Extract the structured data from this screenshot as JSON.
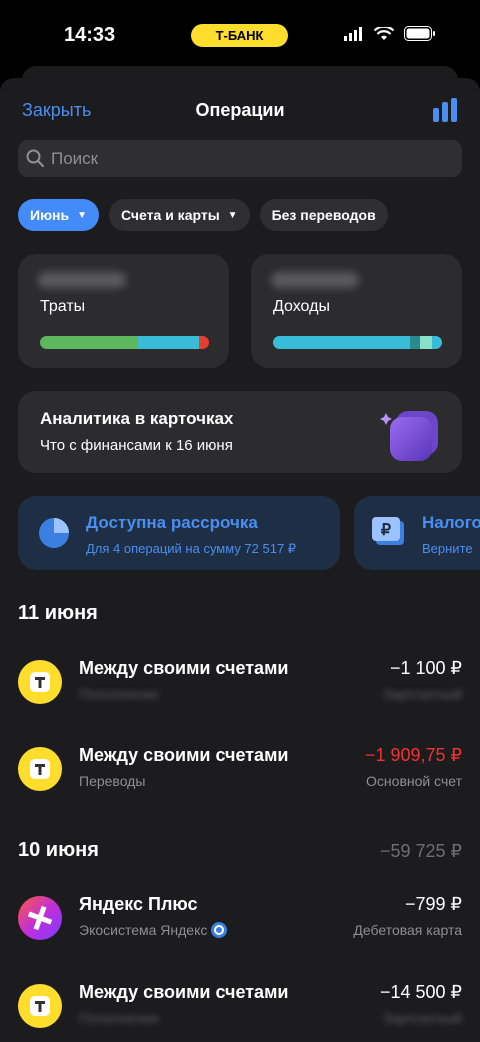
{
  "status_bar": {
    "time": "14:33",
    "bank_badge": "Т-БАНК"
  },
  "header": {
    "close": "Закрыть",
    "title": "Операции"
  },
  "search": {
    "placeholder": "Поиск"
  },
  "filters": [
    {
      "label": "Июнь",
      "active": true,
      "dropdown": true
    },
    {
      "label": "Счета и карты",
      "active": false,
      "dropdown": true
    },
    {
      "label": "Без переводов",
      "active": false,
      "dropdown": false
    }
  ],
  "stats": {
    "spending": {
      "label": "Траты",
      "segments": [
        {
          "color": "#5cb75f",
          "share": 0.58
        },
        {
          "color": "#38bcd8",
          "share": 0.36
        },
        {
          "color": "#e83d2e",
          "share": 0.06
        }
      ]
    },
    "income": {
      "label": "Доходы",
      "segments": [
        {
          "color": "#38bcd8",
          "share": 0.81
        },
        {
          "color": "#2a8a92",
          "share": 0.06
        },
        {
          "color": "#88e0c8",
          "share": 0.07
        },
        {
          "color": "#38bcd8",
          "share": 0.06
        }
      ]
    }
  },
  "analytics_card": {
    "title": "Аналитика в карточках",
    "subtitle": "Что с финансами к 16 июня"
  },
  "promos": [
    {
      "title": "Доступна рассрочка",
      "subtitle": "Для 4 операций на сумму 72 517 ₽",
      "icon": "pie-chart-icon"
    },
    {
      "title": "Налоговый вычет",
      "subtitle": "Верните",
      "icon": "ruble-document-icon"
    }
  ],
  "days": [
    {
      "date": "11 июня",
      "total": "",
      "operations": [
        {
          "name": "Между своими счетами",
          "category": "Пополнение",
          "amount": "−1 100 ₽",
          "account": "Зарплатный",
          "amount_color": "#ffffff",
          "blur_details": true,
          "logo": "tbank-logo"
        },
        {
          "name": "Между своими счетами",
          "category": "Переводы",
          "amount": "−1 909,75 ₽",
          "account": "Основной счет",
          "amount_color": "#f0332e",
          "blur_details": false,
          "logo": "tbank-logo"
        }
      ]
    },
    {
      "date": "10 июня",
      "total": "−59 725 ₽",
      "operations": [
        {
          "name": "Яндекс Плюс",
          "category": "Экосистема Яндекс",
          "amount": "−799 ₽",
          "account": "Дебетовая карта",
          "amount_color": "#ffffff",
          "blur_details": false,
          "logo": "yandex-plus-logo"
        },
        {
          "name": "Между своими счетами",
          "category": "Пополнение",
          "amount": "−14 500 ₽",
          "account": "Зарплатный",
          "amount_color": "#ffffff",
          "blur_details": true,
          "logo": "tbank-logo"
        }
      ]
    }
  ]
}
